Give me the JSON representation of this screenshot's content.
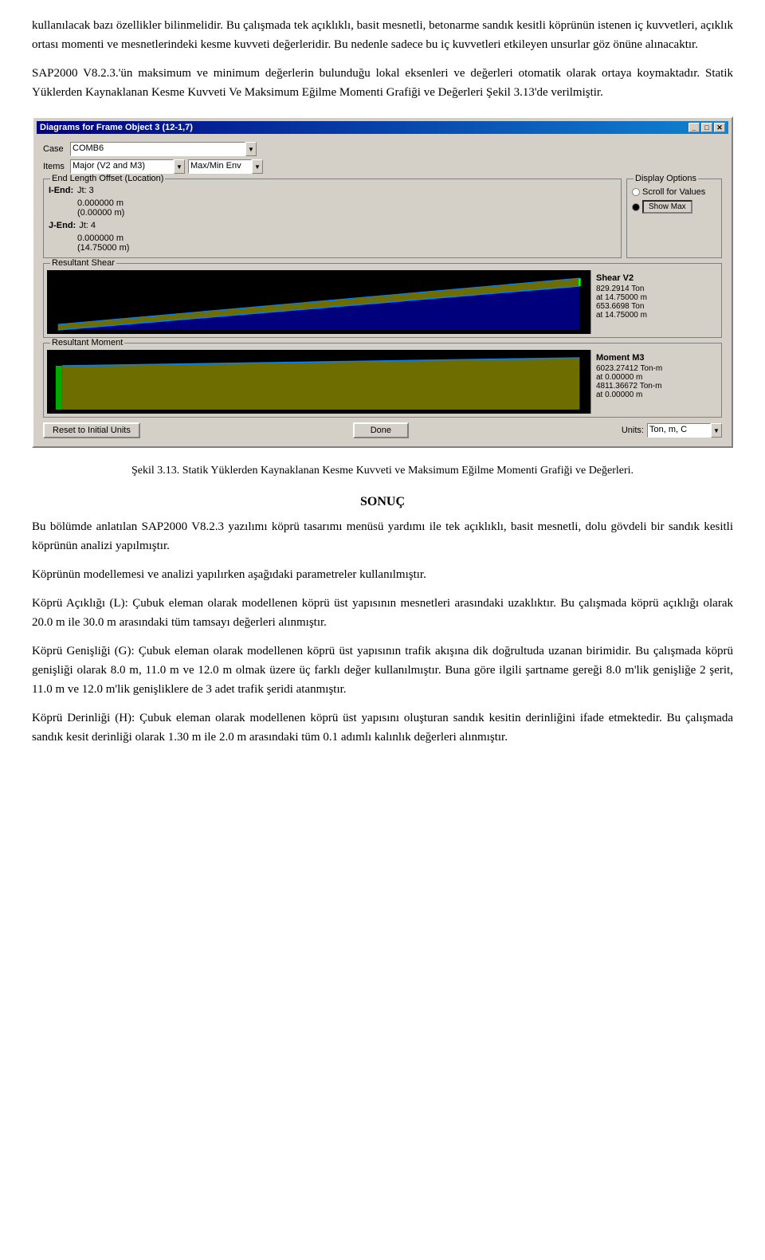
{
  "page": {
    "para1": "kullanılacak bazı özellikler bilinmelidir. Bu çalışmada tek açıklıklı, basit mesnetli, betonarme sandık kesitli köprünün istenen iç kuvvetleri, açıklık ortası momenti ve mesnetlerindeki kesme kuvveti değerleridir. Bu nedenle sadece bu iç kuvvetleri etkileyen unsurlar göz önüne alınacaktır.",
    "para2": "SAP2000 V8.2.3.'ün maksimum ve minimum değerlerin bulunduğu lokal eksenleri ve değerleri otomatik olarak ortaya koymaktadır. Statik Yüklerden Kaynaklanan Kesme Kuvveti Ve Maksimum Eğilme Momenti Grafiği ve Değerleri Şekil 3.13'de verilmiştir.",
    "dialog": {
      "title": "Diagrams for Frame Object 3 (12-1,7)",
      "titlebar_buttons": [
        "_",
        "□",
        "✕"
      ],
      "case_label": "Case",
      "case_value": "COMB6",
      "items_label": "Items",
      "items_value": "Major (V2 and M3)",
      "items_combo2": "Max/Min Env",
      "end_length_title": "End Length Offset (Location)",
      "iend_label": "I-End:",
      "iend_jt": "Jt: 3",
      "iend_val1": "0.000000 m",
      "iend_val2": "(0.00000 m)",
      "jend_label": "J-End:",
      "jend_jt": "Jt: 4",
      "jend_val1": "0.000000 m",
      "jend_val2": "(14.75000 m)",
      "display_title": "Display Options",
      "radio1_label": "Scroll for Values",
      "radio2_label": "Show Max",
      "shear_group": "Resultant Shear",
      "shear_info_title": "Shear V2",
      "shear_val1": "829.2914 Ton",
      "shear_val2": "at 14.75000 m",
      "shear_val3": "653.6698 Ton",
      "shear_val4": "at 14.75000 m",
      "moment_group": "Resultant Moment",
      "moment_info_title": "Moment M3",
      "moment_val1": "6023.27412 Ton-m",
      "moment_val2": "at 0.00000 m",
      "moment_val3": "4811.36672 Ton-m",
      "moment_val4": "at 0.00000 m",
      "btn_reset": "Reset to Initial Units",
      "btn_done": "Done",
      "units_label": "Units:",
      "units_value": "Ton, m, C"
    },
    "figure_label": "Şekil 3.13.",
    "figure_caption": "Statik Yüklerden Kaynaklanan Kesme Kuvveti ve Maksimum Eğilme Momenti Grafiği ve Değerleri.",
    "sonuc_title": "SONUÇ",
    "para3": "Bu bölümde anlatılan SAP2000 V8.2.3 yazılımı köprü tasarımı menüsü yardımı ile tek açıklıklı, basit mesnetli, dolu gövdeli bir sandık kesitli köprünün analizi yapılmıştır.",
    "para4": "Köprünün modellemesi ve analizi yapılırken aşağıdaki parametreler kullanılmıştır.",
    "para5": "Köprü Açıklığı (L): Çubuk eleman olarak modellenen köprü üst yapısının mesnetleri arasındaki uzaklıktır. Bu çalışmada köprü açıklığı olarak 20.0 m ile 30.0 m arasındaki tüm tamsayı değerleri alınmıştır.",
    "para6": "Köprü Genişliği (G): Çubuk eleman olarak modellenen köprü üst yapısının trafik akışına dik doğrultuda uzanan birimidir. Bu çalışmada köprü genişliği olarak 8.0 m, 11.0 m ve 12.0 m olmak üzere üç farklı değer kullanılmıştır. Buna göre ilgili şartname gereği 8.0 m'lik genişliğe 2 şerit, 11.0 m ve 12.0 m'lik genişliklere de 3 adet trafik şeridi atanmıştır.",
    "para7": "Köprü Derinliği (H): Çubuk eleman olarak modellenen köprü üst yapısını oluşturan sandık kesitin derinliğini ifade etmektedir. Bu çalışmada sandık kesit derinliği olarak 1.30 m ile 2.0 m arasındaki tüm 0.1 adımlı kalınlık değerleri alınmıştır."
  }
}
